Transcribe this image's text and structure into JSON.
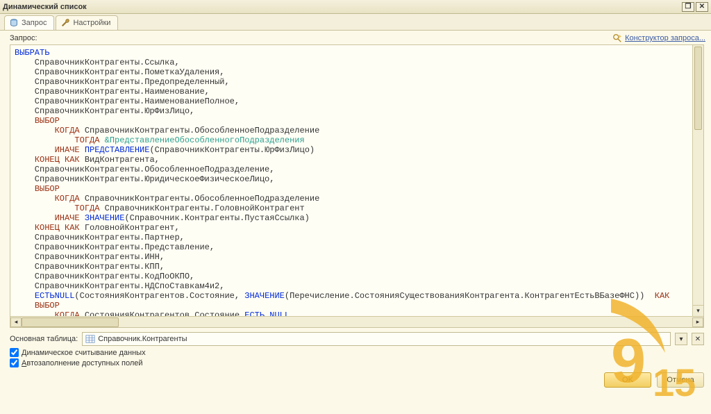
{
  "title": "Динамический список",
  "tabs": {
    "query": "Запрос",
    "settings": "Настройки"
  },
  "labels": {
    "query": "Запрос:",
    "constructor": "Конструктор запроса...",
    "base_table": "Основная таблица:",
    "dynamic_read": "Динамическое считывание данных",
    "autofill_fields": "Автозаполнение доступных полей"
  },
  "base_table_value": "Справочник.Контрагенты",
  "buttons": {
    "ok": "OK",
    "cancel": "Отмена"
  },
  "kw": {
    "select": "ВЫБРАТЬ",
    "case": "ВЫБОР",
    "when": "КОГДА",
    "then": "ТОГДА",
    "else": "ИНАЧЕ",
    "end": "КОНЕЦ",
    "as": "КАК",
    "present": "ПРЕДСТАВЛЕНИЕ",
    "value": "ЗНАЧЕНИЕ",
    "isnull": "ЕСТЬNULL",
    "is": "ЕСТЬ",
    "null": "NULL"
  },
  "q": {
    "l1": "    СправочникКонтрагенты.Ссылка,",
    "l2": "    СправочникКонтрагенты.ПометкаУдаления,",
    "l3": "    СправочникКонтрагенты.Предопределенный,",
    "l4": "    СправочникКонтрагенты.Наименование,",
    "l5": "    СправочникКонтрагенты.НаименованиеПолное,",
    "l6": "    СправочникКонтрагенты.ЮрФизЛицо,",
    "when1": " СправочникКонтрагенты.ОбособленноеПодразделение",
    "then1_param": "&ПредставлениеОбособленногоПодразделения",
    "else1_arg": "(СправочникКонтрагенты.ЮрФизЛицо)",
    "end1_alias": " ВидКонтрагента,",
    "l7": "    СправочникКонтрагенты.ОбособленноеПодразделение,",
    "l8": "    СправочникКонтрагенты.ЮридическоеФизическоеЛицо,",
    "when2": " СправочникКонтрагенты.ОбособленноеПодразделение",
    "then2": " СправочникКонтрагенты.ГоловнойКонтрагент",
    "else2_arg": "(Справочник.Контрагенты.ПустаяСсылка)",
    "end2_alias": " ГоловнойКонтрагент,",
    "l9": "    СправочникКонтрагенты.Партнер,",
    "l10": "    СправочникКонтрагенты.Представление,",
    "l11": "    СправочникКонтрагенты.ИНН,",
    "l12": "    СправочникКонтрагенты.КПП,",
    "l13": "    СправочникКонтрагенты.КодПоОКПО,",
    "l14": "    СправочникКонтрагенты.НДСпоСтавкам4и2,",
    "isnull_pre": "(СостоянияКонтрагентов.Состояние, ",
    "isnull_value_arg": "(Перечисление.СостоянияСуществованияКонтрагента.КонтрагентЕстьВБазеФНС))  ",
    "when3": " СостоянияКонтрагентов.Состояние "
  }
}
